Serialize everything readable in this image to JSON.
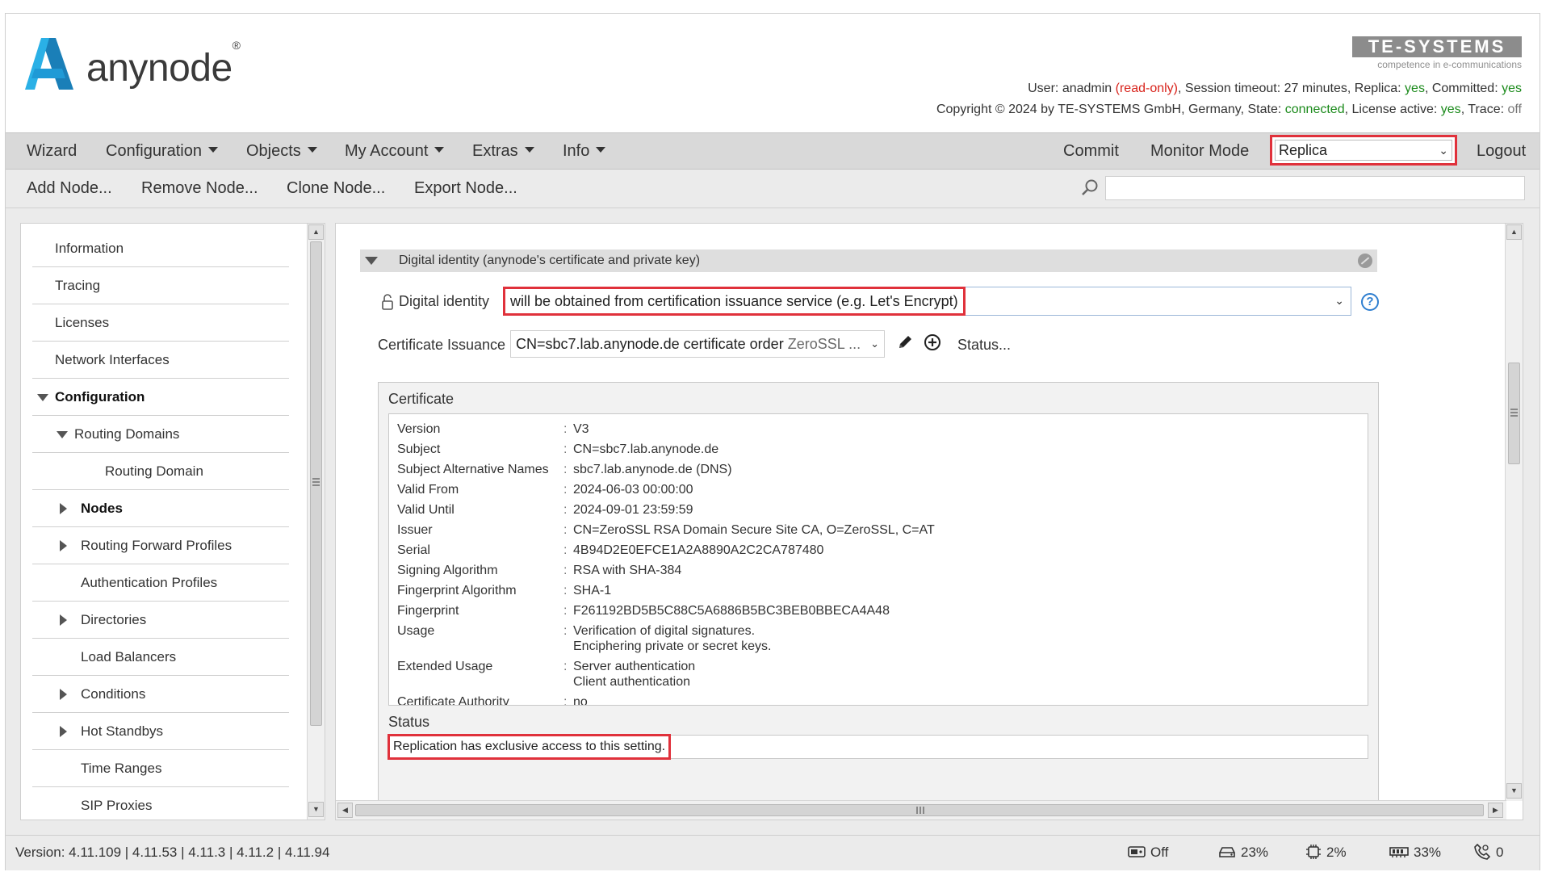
{
  "header": {
    "logo_text": "anynode",
    "logo_mark": "®",
    "brand": "TE-SYSTEMS",
    "brand_tagline": "competence in e-communications",
    "user_label": "User:",
    "user_name": "anadmin",
    "user_mode": "(read-only)",
    "session_label": ", Session timeout:",
    "session_value": "27 minutes",
    "replica_label": ", Replica:",
    "replica_value": "yes",
    "committed_label": ", Committed:",
    "committed_value": "yes",
    "copyright": "Copyright © 2024 by TE-SYSTEMS GmbH, Germany, State:",
    "state_value": "connected",
    "license_label": ", License active:",
    "license_value": "yes",
    "trace_label": ", Trace:",
    "trace_value": "off"
  },
  "menubar": {
    "wizard": "Wizard",
    "configuration": "Configuration",
    "objects": "Objects",
    "my_account": "My Account",
    "extras": "Extras",
    "info": "Info",
    "commit": "Commit",
    "monitor_mode": "Monitor Mode",
    "node_select": "Replica",
    "logout": "Logout"
  },
  "toolbar": {
    "add_node": "Add Node...",
    "remove_node": "Remove Node...",
    "clone_node": "Clone Node...",
    "export_node": "Export Node...",
    "search_value": ""
  },
  "sidebar": {
    "items": [
      {
        "label": "Information"
      },
      {
        "label": "Tracing"
      },
      {
        "label": "Licenses"
      },
      {
        "label": "Network Interfaces"
      },
      {
        "label": "Configuration"
      },
      {
        "label": "Routing Domains"
      },
      {
        "label": "Routing Domain"
      },
      {
        "label": "Nodes"
      },
      {
        "label": "Routing Forward Profiles"
      },
      {
        "label": "Authentication Profiles"
      },
      {
        "label": "Directories"
      },
      {
        "label": "Load Balancers"
      },
      {
        "label": "Conditions"
      },
      {
        "label": "Hot Standbys"
      },
      {
        "label": "Time Ranges"
      },
      {
        "label": "SIP Proxies"
      }
    ]
  },
  "main": {
    "section_title": "Digital identity (anynode's certificate and private key)",
    "digital_identity_label": "Digital identity",
    "digital_identity_value": "will be obtained from certification issuance service (e.g. Let's Encrypt)",
    "cert_issuance_label": "Certificate Issuance",
    "cert_issuance_value": "CN=sbc7.lab.anynode.de certificate order",
    "cert_issuance_value_suffix": "ZeroSSL ...",
    "status_link": "Status...",
    "certificate_title": "Certificate",
    "certificate_separator": ":",
    "certificate_rows": [
      {
        "key": "Version",
        "value": "V3"
      },
      {
        "key": "Subject",
        "value": "CN=sbc7.lab.anynode.de"
      },
      {
        "key": "Subject Alternative Names",
        "value": "sbc7.lab.anynode.de (DNS)"
      },
      {
        "key": "Valid From",
        "value": "2024-06-03 00:00:00"
      },
      {
        "key": "Valid Until",
        "value": "2024-09-01 23:59:59"
      },
      {
        "key": "Issuer",
        "value": "CN=ZeroSSL RSA Domain Secure Site CA, O=ZeroSSL, C=AT"
      },
      {
        "key": "Serial",
        "value": "4B94D2E0EFCE1A2A8890A2C2CA787480"
      },
      {
        "key": "Signing Algorithm",
        "value": "RSA with SHA-384"
      },
      {
        "key": "Fingerprint Algorithm",
        "value": "SHA-1"
      },
      {
        "key": "Fingerprint",
        "value": "F261192BD5B5C88C5A6886B5BC3BEB0BBECA4A48"
      },
      {
        "key": "Usage",
        "value": "Verification of digital signatures.",
        "value2": "Enciphering private or secret keys."
      },
      {
        "key": "Extended Usage",
        "value": "Server authentication",
        "value2": "Client authentication"
      },
      {
        "key": "Certificate Authority",
        "value": "no"
      }
    ],
    "status_title": "Status",
    "status_text": "Replication has exclusive access to this setting."
  },
  "footer": {
    "version": "Version: 4.11.109 | 4.11.53 | 4.11.3 | 4.11.2 | 4.11.94",
    "recording": "Off",
    "disk": "23%",
    "cpu": "2%",
    "memory": "33%",
    "calls": "0"
  },
  "colors": {
    "highlight": "#e0313b",
    "brand_blue": "#1f9ad6",
    "ok_green": "#1b8a1b",
    "warn_red": "#d8231b"
  },
  "icons": {
    "logo": "anynode-a-logo-icon",
    "search": "search-icon",
    "lock": "lock-open-icon",
    "help": "help-icon",
    "edit": "pencil-icon",
    "add": "plus-circle-icon",
    "recording": "recording-icon",
    "disk": "disk-icon",
    "cpu": "cpu-icon",
    "memory": "memory-icon",
    "calls": "phone-icon"
  }
}
